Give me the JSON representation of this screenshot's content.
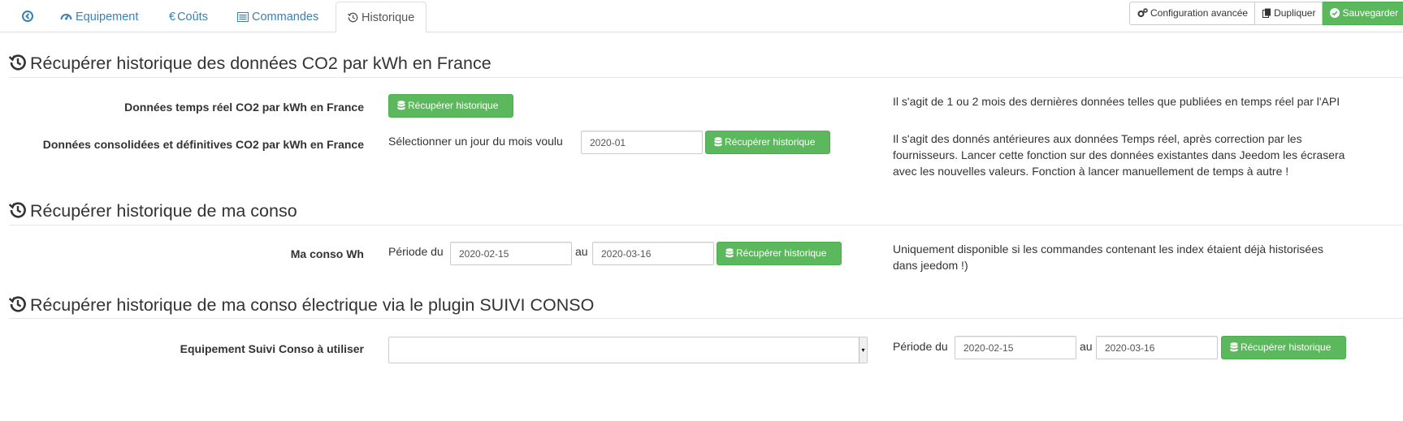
{
  "tabs": [
    {
      "label": "",
      "icon": "circle-arrow-left-icon"
    },
    {
      "label": "Equipement",
      "icon": "tachometer-icon"
    },
    {
      "label": "Coûts",
      "icon": "euro-icon"
    },
    {
      "label": "Commandes",
      "icon": "list-alt-icon"
    },
    {
      "label": "Historique",
      "icon": "history-icon"
    }
  ],
  "toolbar": {
    "config_label": "Configuration avancée",
    "duplicate_label": "Dupliquer",
    "save_label": "Sauvegarder"
  },
  "sections": [
    {
      "title": "Récupérer historique des données CO2 par kWh en France",
      "rows": [
        {
          "label": "Données temps réel CO2 par kWh en France",
          "button": "Récupérer historique",
          "help": "Il s'agit de 1 ou 2 mois des dernières données telles que publiées en temps réel par l'API"
        },
        {
          "label": "Données consolidées et définitives CO2 par kWh en France",
          "prefix": "Sélectionner un jour du mois voulu",
          "month_value": "2020-01",
          "button": "Récupérer historique",
          "help_lines": [
            "Il s'agit des donnés antérieures aux données Temps réel, après correction par les",
            "fournisseurs. Lancer cette fonction sur des données existantes dans Jeedom les écrasera",
            "avec les nouvelles valeurs. Fonction à lancer manuellement de temps à autre !"
          ]
        }
      ]
    },
    {
      "title": "Récupérer historique de ma conso",
      "rows": [
        {
          "label": "Ma conso Wh",
          "period_from_label": "Période du",
          "from_value": "2020-02-15",
          "to_label": "au",
          "to_value": "2020-03-16",
          "button": "Récupérer historique",
          "help_lines": [
            "Uniquement disponible si les commandes contenant les index étaient déjà historisées",
            "dans jeedom !)"
          ]
        }
      ]
    },
    {
      "title": "Récupérer historique de ma conso électrique via le plugin SUIVI CONSO",
      "rows": [
        {
          "label": "Equipement Suivi Conso à utiliser",
          "select_value": "",
          "period_from_label": "Période du",
          "from_value": "2020-02-15",
          "to_label": "au",
          "to_value": "2020-03-16",
          "button": "Récupérer historique"
        }
      ]
    }
  ],
  "colors": {
    "link": "#3c7fb1",
    "success": "#5cb85c",
    "border": "#dddddd"
  }
}
